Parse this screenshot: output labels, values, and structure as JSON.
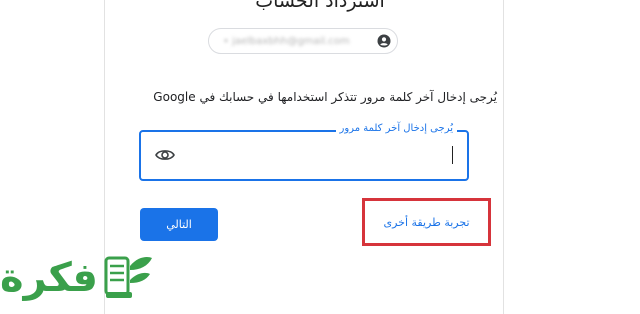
{
  "header": {
    "title": "استرداد الحساب"
  },
  "account": {
    "email": "• jaelbaxbhh@gmail.com",
    "avatar_icon": "account-circle-icon"
  },
  "instruction": "يُرجى إدخال آخر كلمة مرور تتذكر استخدامها في حسابك في Google",
  "password": {
    "label": "يُرجى إدخال آخر كلمة مرور",
    "value": "",
    "toggle_icon": "eye-icon"
  },
  "actions": {
    "next_label": "التالي",
    "try_another_label": "تجربة طريقة أخرى"
  },
  "logo": {
    "text": "فكرة",
    "icon": "book-with-leaf-icon"
  },
  "colors": {
    "accent": "#1a73e8",
    "highlight": "#d6343b",
    "brand": "#3aa04b"
  }
}
